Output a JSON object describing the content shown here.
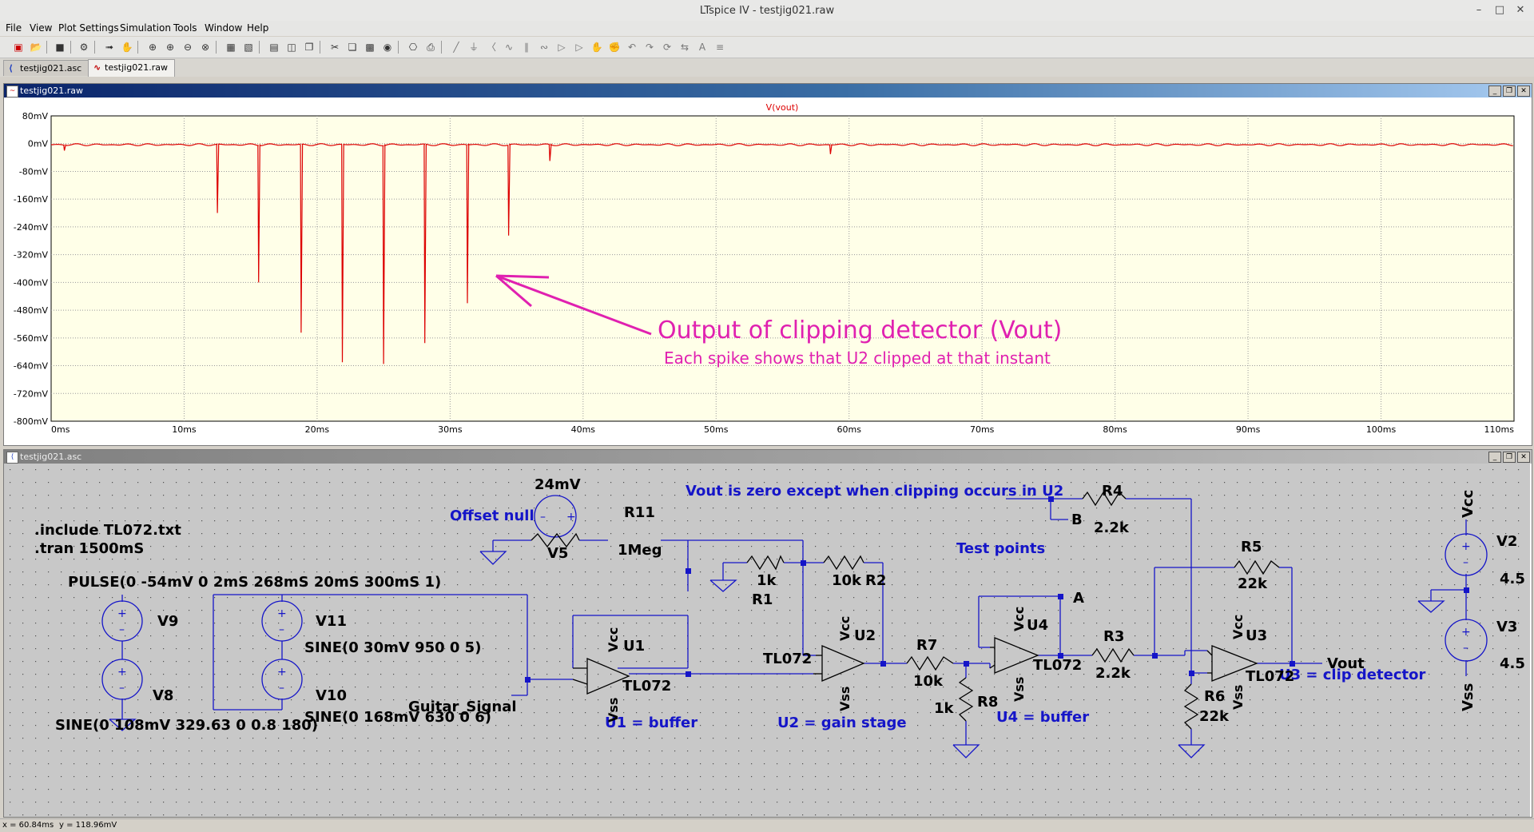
{
  "window": {
    "title": "LTspice IV - testjig021.raw"
  },
  "menu": [
    "File",
    "View",
    "Plot Settings",
    "Simulation",
    "Tools",
    "Window",
    "Help"
  ],
  "tabs": [
    {
      "label": "testjig021.asc",
      "active": false
    },
    {
      "label": "testjig021.raw",
      "active": true
    }
  ],
  "waveform_window": {
    "title": "testjig021.raw"
  },
  "schematic_window": {
    "title": "testjig021.asc"
  },
  "chart_data": {
    "type": "line",
    "title": "V(vout)",
    "xlabel": "",
    "ylabel": "",
    "xlim": [
      0,
      110
    ],
    "ylim": [
      -800,
      80
    ],
    "x_ticks": [
      "0ms",
      "10ms",
      "20ms",
      "30ms",
      "40ms",
      "50ms",
      "60ms",
      "70ms",
      "80ms",
      "90ms",
      "100ms",
      "110ms"
    ],
    "y_ticks": [
      "80mV",
      "0mV",
      "-80mV",
      "-160mV",
      "-240mV",
      "-320mV",
      "-400mV",
      "-480mV",
      "-560mV",
      "-640mV",
      "-720mV",
      "-800mV"
    ],
    "grid": true,
    "line_color": "#dd0000",
    "series": [
      {
        "name": "V(vout)",
        "spikes": [
          {
            "x": 1.0,
            "y": -20
          },
          {
            "x": 12.5,
            "y": -200
          },
          {
            "x": 15.6,
            "y": -400
          },
          {
            "x": 18.8,
            "y": -545
          },
          {
            "x": 21.9,
            "y": -630
          },
          {
            "x": 25.0,
            "y": -635
          },
          {
            "x": 28.1,
            "y": -575
          },
          {
            "x": 31.3,
            "y": -460
          },
          {
            "x": 34.4,
            "y": -265
          },
          {
            "x": 37.5,
            "y": -50
          },
          {
            "x": 58.6,
            "y": -30
          }
        ]
      }
    ],
    "annotations": [
      {
        "text": "Output of clipping detector (Vout)",
        "color": "#e020b0"
      },
      {
        "text": "Each spike shows that U2 clipped at that instant",
        "color": "#e020b0"
      }
    ]
  },
  "schematic": {
    "directives": [
      ".include TL072.txt",
      ".tran 1500mS"
    ],
    "notes": [
      "Vout  is zero except when clipping occurs in U2",
      "Offset null",
      "Test points",
      "U1 = buffer",
      "U2 = gain stage",
      "U4 = buffer",
      "U3 = clip detector"
    ],
    "sources": [
      {
        "ref": "V9",
        "value": "PULSE(0 -54mV 0 2mS 268mS 20mS 300mS 1)"
      },
      {
        "ref": "V11",
        "value": "SINE(0 30mV 950 0 5)"
      },
      {
        "ref": "V8",
        "value": "SINE(0 108mV 329.63 0 0.8 180)"
      },
      {
        "ref": "V10",
        "value": "SINE(0 168mV 630 0 6)"
      },
      {
        "ref": "V5",
        "value": "24mV"
      },
      {
        "ref": "V2",
        "value": "4.5"
      },
      {
        "ref": "V3",
        "value": "4.5"
      }
    ],
    "resistors": [
      {
        "ref": "R11",
        "value": "1Meg"
      },
      {
        "ref": "R1",
        "value": "1k"
      },
      {
        "ref": "R2",
        "value": "10k"
      },
      {
        "ref": "R7",
        "value": "10k"
      },
      {
        "ref": "R8",
        "value": "1k"
      },
      {
        "ref": "R3",
        "value": "2.2k"
      },
      {
        "ref": "R4",
        "value": "2.2k"
      },
      {
        "ref": "R5",
        "value": "22k"
      },
      {
        "ref": "R6",
        "value": "22k"
      }
    ],
    "opamps": [
      {
        "ref": "U1",
        "model": "TL072"
      },
      {
        "ref": "U2",
        "model": "TL072"
      },
      {
        "ref": "U4",
        "model": "TL072"
      },
      {
        "ref": "U3",
        "model": "TL072"
      }
    ],
    "net_labels": {
      "guitar": "Guitar_Signal",
      "vout": "Vout",
      "a": "A",
      "b": "B",
      "vcc": "Vcc",
      "vss": "Vss"
    }
  },
  "status": {
    "x": "x = 60.84ms",
    "y": "y = 118.96mV"
  }
}
